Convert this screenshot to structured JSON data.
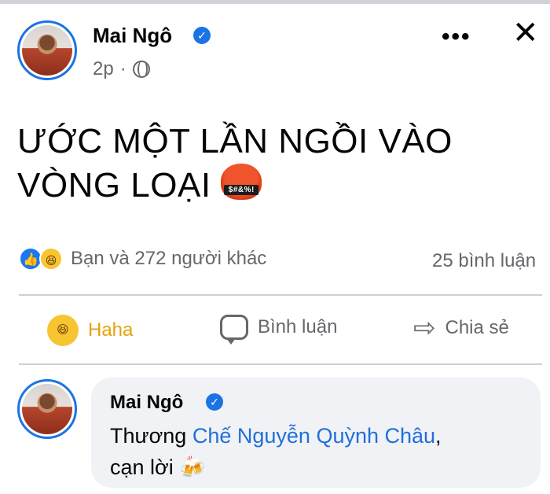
{
  "post": {
    "author": "Mai Ngô",
    "time": "2p",
    "separator": "·",
    "text_line1": "ƯỚC MỘT LẦN NGỒI VÀO",
    "text_line2": "VÒNG LOẠI",
    "more_glyph": "•••",
    "close_glyph": "✕",
    "emoji_text": "$#&%!"
  },
  "reactions": {
    "summary": "Bạn và 272 người khác",
    "comments": "25 bình luận"
  },
  "actions": {
    "haha": "Haha",
    "comment": "Bình luận",
    "share": "Chia sẻ"
  },
  "comment": {
    "author": "Mai Ngô",
    "prefix": "Thương",
    "mention": "Chế Nguyễn Quỳnh Châu",
    "line1_suffix": ",",
    "line2": "cạn lời",
    "emoji": "🍻"
  },
  "colors": {
    "accent": "#1b74e4",
    "haha_color": "#e3a30a",
    "mention_color": "#216fdb",
    "secondary_text": "#65676b"
  }
}
